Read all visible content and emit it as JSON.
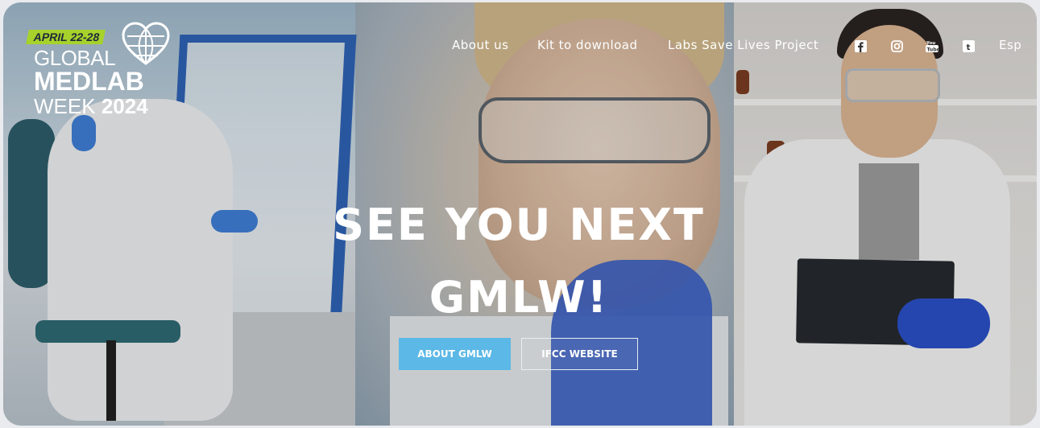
{
  "brand": {
    "badge": "APRIL 22-28",
    "line1": "GLOBAL",
    "line2": "MEDLAB",
    "line3_a": "WEEK",
    "line3_b": "2024",
    "badge_color": "#a6d22b"
  },
  "nav": {
    "links": [
      "About us",
      "Kit to download",
      "Labs Save Lives Project"
    ],
    "social_icons": [
      "facebook-icon",
      "instagram-icon",
      "youtube-icon",
      "tumblr-icon"
    ],
    "language": "Esp"
  },
  "hero": {
    "headline_line1": "SEE YOU NEXT",
    "headline_line2": "GMLW!",
    "buttons": {
      "primary": "ABOUT GMLW",
      "secondary": "IFCC WEBSITE"
    },
    "primary_color": "#5cb8e6"
  }
}
